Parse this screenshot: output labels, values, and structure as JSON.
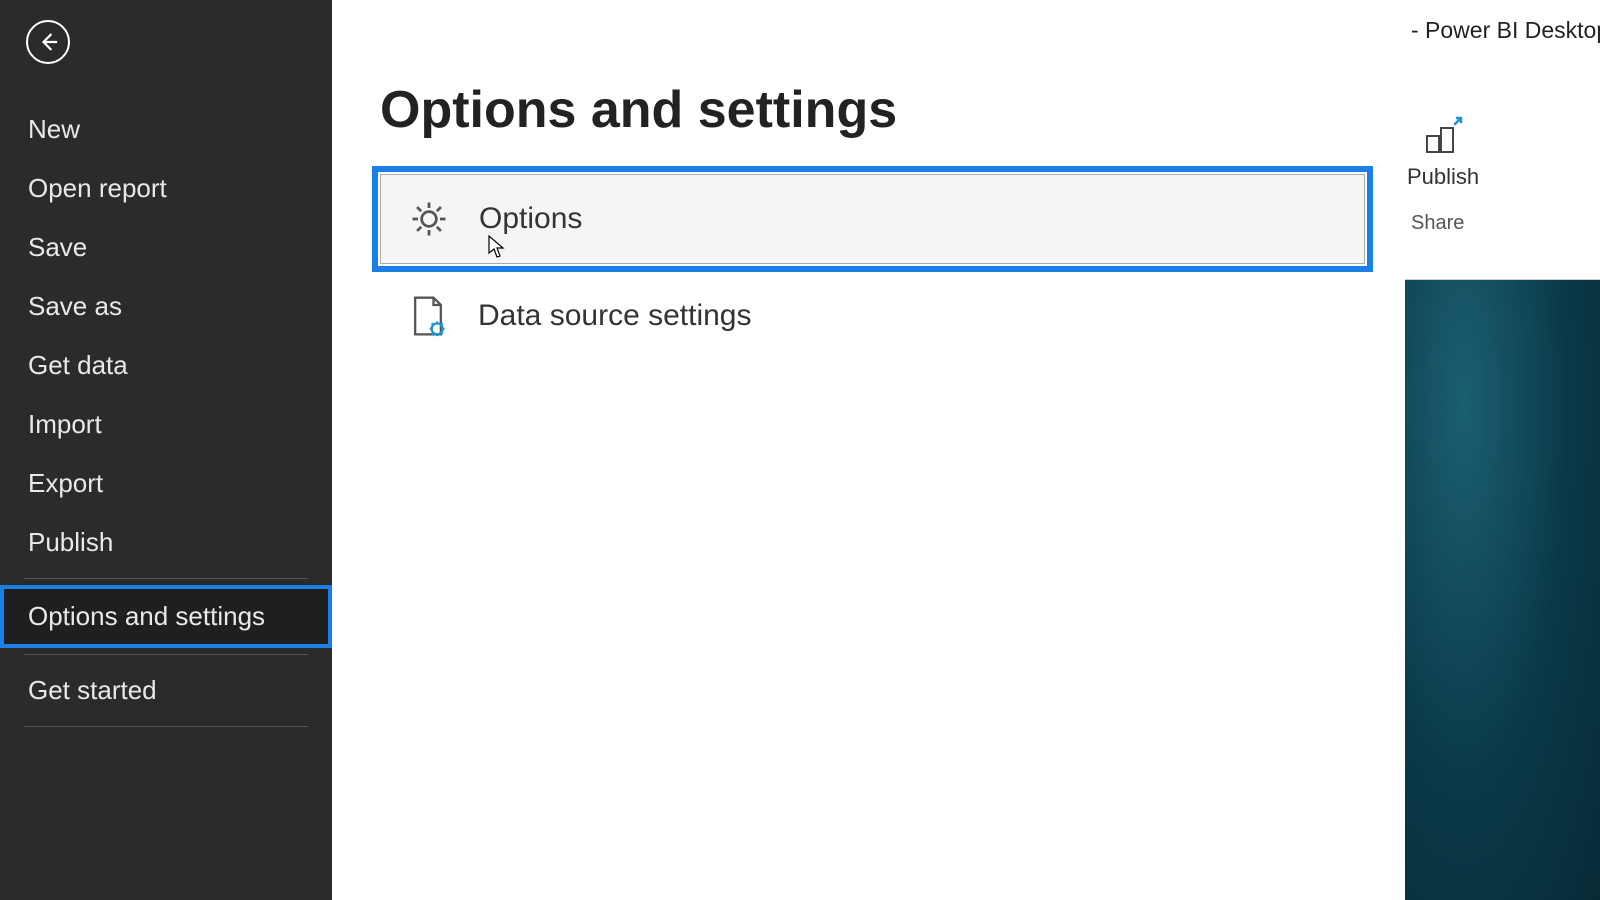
{
  "app_title_fragment": "- Power BI Desktop",
  "sidebar": {
    "items": [
      {
        "label": "New"
      },
      {
        "label": "Open report"
      },
      {
        "label": "Save"
      },
      {
        "label": "Save as"
      },
      {
        "label": "Get data"
      },
      {
        "label": "Import"
      },
      {
        "label": "Export"
      },
      {
        "label": "Publish"
      },
      {
        "label": "Options and settings"
      },
      {
        "label": "Get started"
      }
    ],
    "selected_index": 8
  },
  "main": {
    "title": "Options and settings",
    "options": [
      {
        "label": "Options",
        "highlighted": true
      },
      {
        "label": "Data source settings",
        "highlighted": false
      }
    ]
  },
  "ribbon": {
    "publish_label": "Publish",
    "group_label": "Share"
  },
  "colors": {
    "highlight": "#1a7fe6",
    "sidebar_bg": "#2b2b2b"
  }
}
